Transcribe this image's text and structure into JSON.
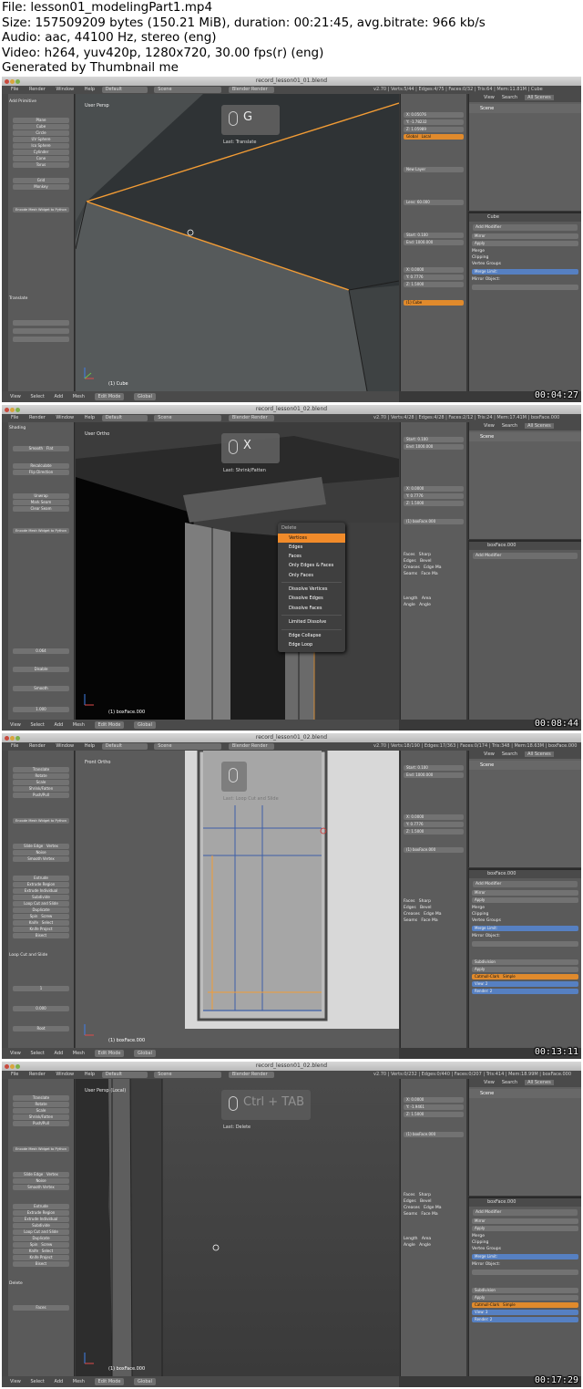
{
  "info": {
    "file": "File: lesson01_modelingPart1.mp4",
    "size": "Size: 157509209 bytes (150.21 MiB), duration: 00:21:45, avg.bitrate: 966 kb/s",
    "audio": "Audio: aac, 44100 Hz, stereo (eng)",
    "video": "Video: h264, yuv420p, 1280x720, 30.00 fps(r) (eng)",
    "generated": "Generated by Thumbnail me"
  },
  "thumbs": [
    {
      "timestamp": "00:04:27",
      "window_title": "record_lesson01_01.blend",
      "stats": "v2.70 | Verts:5/44 | Edges:4/75 | Faces:0/32 | Tris:64 | Mem:11.81M | Cube",
      "view_label": "User Persp",
      "key": "G",
      "last_op": "Last: Translate",
      "object_label": "(1) Cube",
      "mode": "Edit Mode",
      "orientation": "Global"
    },
    {
      "timestamp": "00:08:44",
      "window_title": "record_lesson01_02.blend",
      "stats": "v2.70 | Verts:4/28 | Edges:4/28 | Faces:2/12 | Tris:24 | Mem:17.41M | boxFace.000",
      "view_label": "User Ortho",
      "key": "X",
      "last_op": "Last: Shrink/Fatten",
      "object_label": "(1) boxFace.000",
      "mode": "Edit Mode",
      "orientation": "Global",
      "menu": {
        "title": "Delete",
        "items": [
          "Vertices",
          "Edges",
          "Faces",
          "Only Edges & Faces",
          "Only Faces",
          "Dissolve Vertices",
          "Dissolve Edges",
          "Dissolve Faces",
          "Limited Dissolve",
          "Edge Collapse",
          "Edge Loop"
        ]
      }
    },
    {
      "timestamp": "00:13:11",
      "window_title": "record_lesson01_02.blend",
      "stats": "v2.70 | Verts:18/190 | Edges:17/363 | Faces:0/174 | Tris:348 | Mem:18.63M | boxFace.000",
      "view_label": "Front Ortho",
      "key": "",
      "last_op": "Last: Loop Cut and Slide",
      "object_label": "(1) boxFace.000",
      "mode": "Edit Mode",
      "orientation": "Global"
    },
    {
      "timestamp": "00:17:29",
      "window_title": "record_lesson01_02.blend",
      "stats": "v2.70 | Verts:0/232 | Edges:0/440 | Faces:0/207 | Tris:414 | Mem:18.99M | boxFace.000",
      "view_label": "User Persp (Local)",
      "key": "Ctrl + TAB",
      "last_op": "Last: Delete",
      "object_label": "(1) boxFace.000",
      "mode": "Edit Mode",
      "orientation": "Global"
    }
  ],
  "ui": {
    "menu": [
      "File",
      "Render",
      "Window",
      "Help"
    ],
    "layout": "Default",
    "scene": "Scene",
    "engine": "Blender Render",
    "bottom_menu": [
      "View",
      "Select",
      "Add",
      "Mesh"
    ],
    "outliner_tabs": [
      "View",
      "Search",
      "All Scenes"
    ],
    "outliner_row": "Scene",
    "add_modifier": "Add Modifier",
    "apply": "Apply",
    "copy": "Copy",
    "merge": "Merge",
    "clipping": "Clipping",
    "vertex_groups": "Vertex Groups",
    "merge_limit": "Merge Limit:",
    "mirror_object": "Mirror Object:",
    "toolshelf_items": [
      "Plane",
      "Cube",
      "Circle",
      "UV Sphere",
      "Ico Sphere",
      "Cylinder",
      "Cone",
      "Torus",
      "Grid",
      "Monkey"
    ],
    "translate": "Translate",
    "encode": "Encode Mesh Widget to Python"
  }
}
